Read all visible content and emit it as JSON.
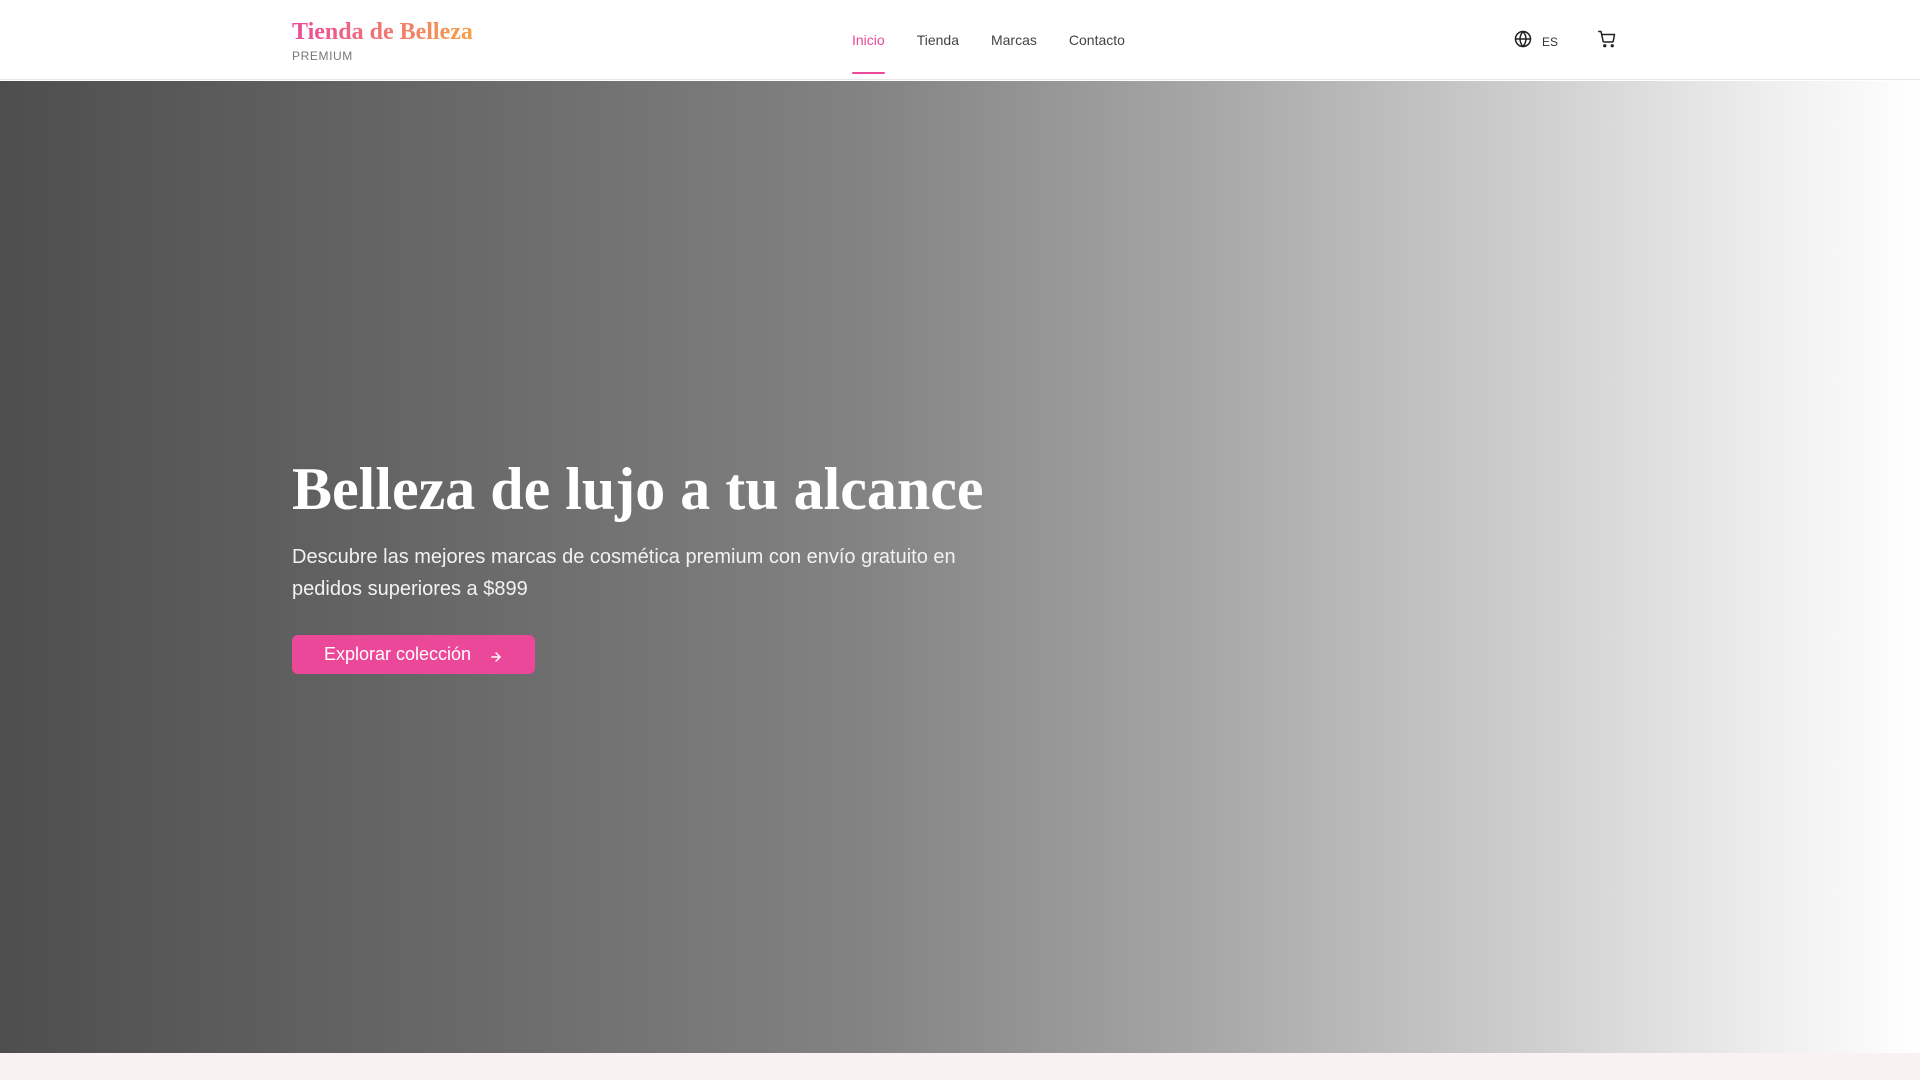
{
  "header": {
    "brand_title": "Tienda de Belleza",
    "brand_subtitle": "PREMIUM",
    "nav": [
      {
        "label": "Inicio",
        "active": true
      },
      {
        "label": "Tienda",
        "active": false
      },
      {
        "label": "Marcas",
        "active": false
      },
      {
        "label": "Contacto",
        "active": false
      }
    ],
    "language_label": "ES",
    "icons": {
      "language": "globe-icon",
      "cart": "cart-icon"
    }
  },
  "hero": {
    "title": "Belleza de lujo a tu alcance",
    "subtitle": "Descubre las mejores marcas de cosmética premium con envío gratuito en pedidos superiores a $899",
    "cta_label": "Explorar colección",
    "cta_icon": "arrow-right-icon"
  },
  "colors": {
    "accent": "#ec4899",
    "brand_gradient_start": "#ec4899",
    "brand_gradient_end": "#f6a04a",
    "bottom_strip": "#f8f2f3"
  }
}
